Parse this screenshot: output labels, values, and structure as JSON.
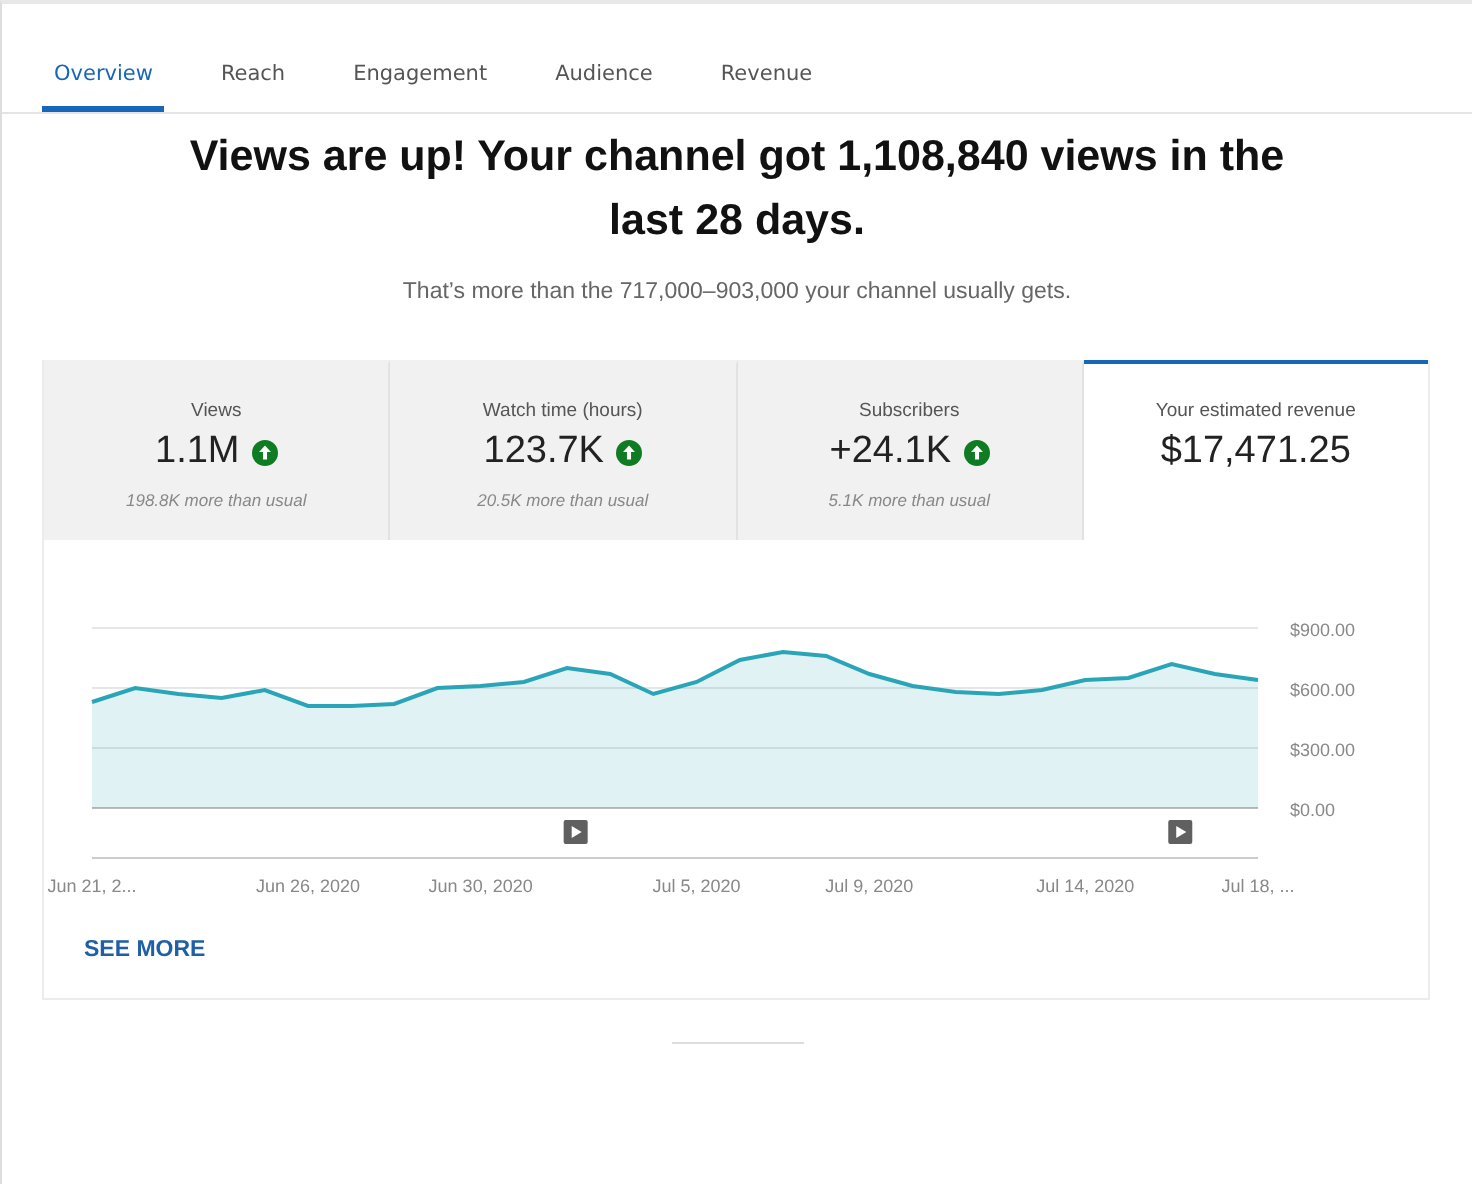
{
  "tabs": [
    {
      "label": "Overview",
      "selected": true
    },
    {
      "label": "Reach",
      "selected": false
    },
    {
      "label": "Engagement",
      "selected": false
    },
    {
      "label": "Audience",
      "selected": false
    },
    {
      "label": "Revenue",
      "selected": false
    }
  ],
  "headline": "Views are up! Your channel got 1,108,840 views in the last 28 days.",
  "subtext": "That’s more than the 717,000–903,000 your channel usually gets.",
  "metrics": [
    {
      "label": "Views",
      "value": "1.1M",
      "up": true,
      "note": "198.8K more than usual",
      "selected": false
    },
    {
      "label": "Watch time (hours)",
      "value": "123.7K",
      "up": true,
      "note": "20.5K more than usual",
      "selected": false
    },
    {
      "label": "Subscribers",
      "value": "+24.1K",
      "up": true,
      "note": "5.1K more than usual",
      "selected": false
    },
    {
      "label": "Your estimated revenue",
      "value": "$17,471.25",
      "selected": true
    }
  ],
  "chart": {
    "chart_data": {
      "type": "area",
      "categories": [
        "Jun 21, 2...",
        null,
        null,
        null,
        null,
        "Jun 26, 2020",
        null,
        null,
        null,
        "Jun 30, 2020",
        null,
        null,
        null,
        null,
        "Jul 5, 2020",
        null,
        null,
        null,
        "Jul 9, 2020",
        null,
        null,
        null,
        null,
        "Jul 14, 2020",
        null,
        null,
        null,
        "Jul 18, ..."
      ],
      "series": [
        {
          "color": "#2aa5b8",
          "values": [
            530,
            600,
            570,
            550,
            590,
            510,
            510,
            520,
            600,
            610,
            630,
            700,
            670,
            570,
            630,
            740,
            780,
            760,
            670,
            610,
            580,
            570,
            590,
            640,
            650,
            720,
            670,
            640
          ]
        }
      ],
      "ylim": [
        0,
        900
      ],
      "yticks": [
        {
          "value": 0,
          "label": "$0.00"
        },
        {
          "value": 300,
          "label": "$300.00"
        },
        {
          "value": 600,
          "label": "$600.00"
        },
        {
          "value": 900,
          "label": "$900.00"
        }
      ]
    }
  },
  "see_more": "SEE MORE"
}
